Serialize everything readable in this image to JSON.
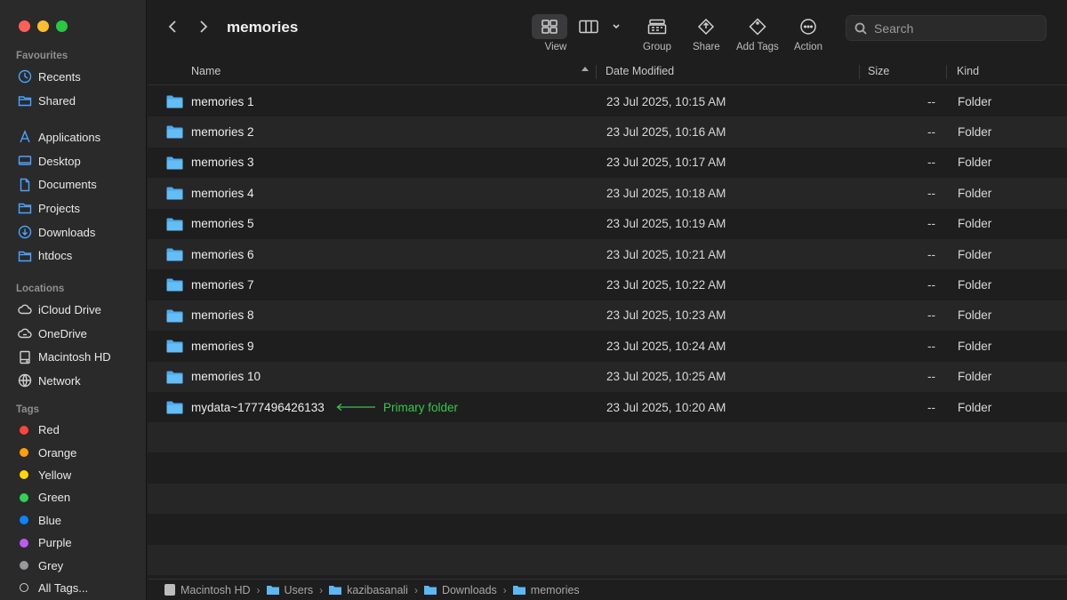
{
  "window": {
    "title": "memories"
  },
  "toolbar": {
    "view_label": "View",
    "group_label": "Group",
    "share_label": "Share",
    "add_tags_label": "Add Tags",
    "action_label": "Action",
    "search_placeholder": "Search"
  },
  "sidebar": {
    "favourites_heading": "Favourites",
    "favourites": [
      {
        "label": "Recents",
        "icon": "clock-icon"
      },
      {
        "label": "Shared",
        "icon": "shared-folder-icon"
      },
      {
        "label": "Applications",
        "icon": "applications-icon"
      },
      {
        "label": "Desktop",
        "icon": "desktop-icon"
      },
      {
        "label": "Documents",
        "icon": "document-icon"
      },
      {
        "label": "Projects",
        "icon": "folder-icon"
      },
      {
        "label": "Downloads",
        "icon": "download-icon"
      },
      {
        "label": "htdocs",
        "icon": "folder-icon"
      }
    ],
    "locations_heading": "Locations",
    "locations": [
      {
        "label": "iCloud Drive",
        "icon": "cloud-icon"
      },
      {
        "label": "OneDrive",
        "icon": "cloud-sync-icon"
      },
      {
        "label": "Macintosh HD",
        "icon": "hard-drive-icon"
      },
      {
        "label": "Network",
        "icon": "globe-icon"
      }
    ],
    "tags_heading": "Tags",
    "tags": [
      {
        "label": "Red",
        "color": "#ff453a"
      },
      {
        "label": "Orange",
        "color": "#ff9f0a"
      },
      {
        "label": "Yellow",
        "color": "#ffd60a"
      },
      {
        "label": "Green",
        "color": "#30d158"
      },
      {
        "label": "Blue",
        "color": "#0a84ff"
      },
      {
        "label": "Purple",
        "color": "#bf5af2"
      },
      {
        "label": "Grey",
        "color": "#98989d"
      },
      {
        "label": "All Tags...",
        "color": ""
      }
    ]
  },
  "columns": {
    "name": "Name",
    "date": "Date Modified",
    "size": "Size",
    "kind": "Kind"
  },
  "files": [
    {
      "name": "memories 1",
      "date": "23 Jul 2025, 10:15 AM",
      "size": "--",
      "kind": "Folder"
    },
    {
      "name": "memories 2",
      "date": "23 Jul 2025, 10:16 AM",
      "size": "--",
      "kind": "Folder"
    },
    {
      "name": "memories 3",
      "date": "23 Jul 2025, 10:17 AM",
      "size": "--",
      "kind": "Folder"
    },
    {
      "name": "memories 4",
      "date": "23 Jul 2025, 10:18 AM",
      "size": "--",
      "kind": "Folder"
    },
    {
      "name": "memories 5",
      "date": "23 Jul 2025, 10:19 AM",
      "size": "--",
      "kind": "Folder"
    },
    {
      "name": "memories 6",
      "date": "23 Jul 2025, 10:21 AM",
      "size": "--",
      "kind": "Folder"
    },
    {
      "name": "memories 7",
      "date": "23 Jul 2025, 10:22 AM",
      "size": "--",
      "kind": "Folder"
    },
    {
      "name": "memories 8",
      "date": "23 Jul 2025, 10:23 AM",
      "size": "--",
      "kind": "Folder"
    },
    {
      "name": "memories 9",
      "date": "23 Jul 2025, 10:24 AM",
      "size": "--",
      "kind": "Folder"
    },
    {
      "name": "memories 10",
      "date": "23 Jul 2025, 10:25 AM",
      "size": "--",
      "kind": "Folder"
    },
    {
      "name": "mydata~1777496426133",
      "date": "23 Jul 2025, 10:20 AM",
      "size": "--",
      "kind": "Folder"
    }
  ],
  "annotation": {
    "text": "Primary folder",
    "color": "#33c94a"
  },
  "pathbar": [
    "Macintosh HD",
    "Users",
    "kazibasanali",
    "Downloads",
    "memories"
  ],
  "colors": {
    "accent": "#4aa3ff",
    "folder": "#5cb8f5"
  }
}
